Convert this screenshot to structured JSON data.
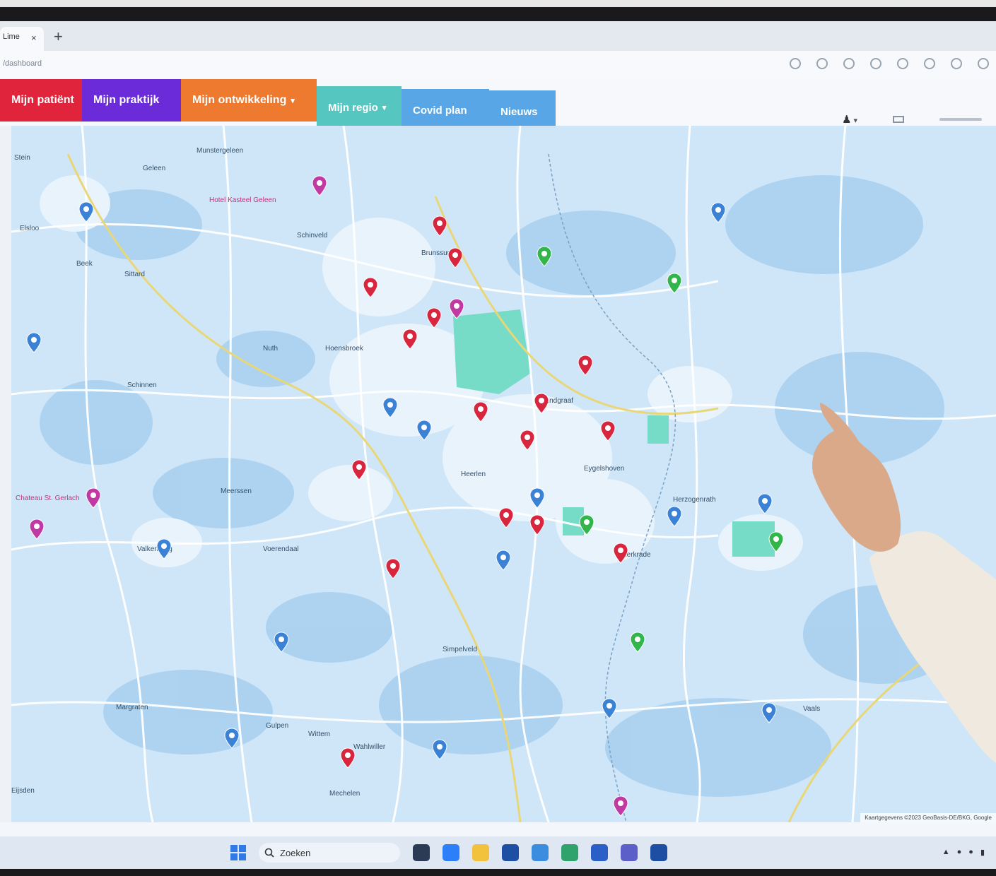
{
  "browser": {
    "tab_label": "Lime",
    "tab_close": "×",
    "new_tab": "+",
    "url": "/dashboard"
  },
  "nav": {
    "items": [
      {
        "label": "Mijn patiënt",
        "color": "#e0243c"
      },
      {
        "label": "Mijn praktijk",
        "color": "#6c2bd9"
      },
      {
        "label": "Mijn ontwikkeling",
        "color": "#ee7a2f",
        "dropdown": true
      },
      {
        "label": "Mijn regio",
        "color": "#56c7c0",
        "dropdown": true
      },
      {
        "label": "Covid plan",
        "color": "#58a6e6"
      },
      {
        "label": "Nieuws",
        "color": "#58a6e6"
      }
    ],
    "caret": "▾"
  },
  "user": {
    "icon": "user-icon",
    "menu": "▾"
  },
  "map": {
    "places": [
      {
        "name": "Stein"
      },
      {
        "name": "Elsloo"
      },
      {
        "name": "Beek"
      },
      {
        "name": "Geleen"
      },
      {
        "name": "Munstergeleen"
      },
      {
        "name": "Schinveld"
      },
      {
        "name": "Sittard"
      },
      {
        "name": "Brunssum"
      },
      {
        "name": "Nuth"
      },
      {
        "name": "Schinnen"
      },
      {
        "name": "Hoensbroek"
      },
      {
        "name": "Heerlen"
      },
      {
        "name": "Landgraaf"
      },
      {
        "name": "Kerkrade"
      },
      {
        "name": "Voerendaal"
      },
      {
        "name": "Simpelveld"
      },
      {
        "name": "Valkenburg"
      },
      {
        "name": "Meerssen"
      },
      {
        "name": "Margraten"
      },
      {
        "name": "Gulpen"
      },
      {
        "name": "Wittem"
      },
      {
        "name": "Vaals"
      },
      {
        "name": "Eygelshoven"
      },
      {
        "name": "Herzogenrath"
      },
      {
        "name": "Wahlwiller"
      },
      {
        "name": "Mechelen"
      },
      {
        "name": "Eijsden"
      }
    ],
    "pois": [
      {
        "name": "Hotel Kasteel Geleen"
      },
      {
        "name": "Chateau St. Gerlach"
      }
    ],
    "attribution": "Kaartgegevens ©2023 GeoBasis-DE/BKG, Google"
  },
  "taskbar": {
    "search_label": "Zoeken",
    "search_icon": "search-icon",
    "start_icon": "windows-start-icon"
  },
  "colors": {
    "map_water": "#b8d9f3",
    "map_land": "#cfe6f8",
    "road": "#ffffff",
    "highway": "#f7e37a",
    "pin_red": "#d7263d",
    "pin_blue": "#3b82d6",
    "pin_green": "#32b54a",
    "pin_magenta": "#c13aa3"
  }
}
